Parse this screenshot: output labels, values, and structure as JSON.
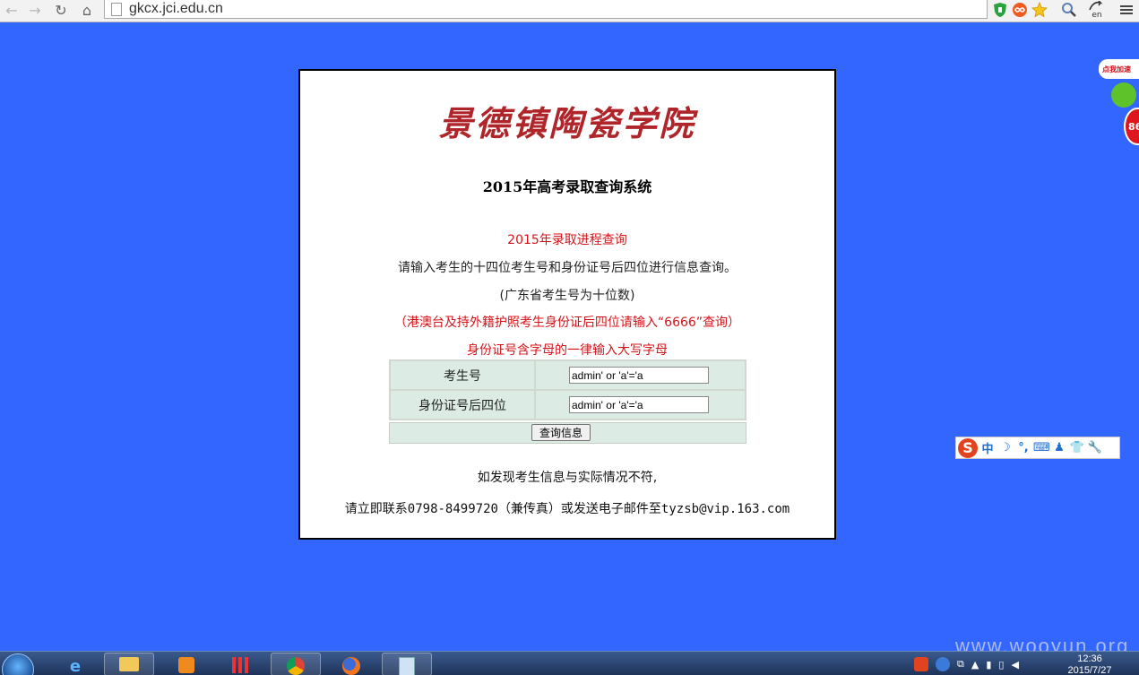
{
  "browser": {
    "url": "gkcx.jci.edu.cn",
    "nav": {
      "back": "←",
      "forward": "→",
      "reload": "↻",
      "home": "⌂"
    },
    "right_icons": [
      "shield-icon",
      "infinity-icon",
      "star-icon",
      "search-zoom-icon",
      "translate-icon",
      "menu-icon"
    ],
    "translate_label": "en"
  },
  "page": {
    "logo_text": "景德镇陶瓷学院",
    "system_title": "2015年高考录取查询系统",
    "progress_title": "2015年录取进程查询",
    "instruction": "请输入考生的十四位考生号和身份证号后四位进行信息查询。",
    "guangdong_note": "(广东省考生号为十位数)",
    "hmt_note": "（港澳台及持外籍护照考生身份证后四位请输入“6666”查询）",
    "uppercase_note": "身份证号含字母的一律输入大写字母",
    "form": {
      "exam_no_label": "考生号",
      "exam_no_value": "admin' or 'a'='a",
      "id_last4_label": "身份证号后四位",
      "id_last4_value": "admin' or 'a'='a",
      "submit_label": "查询信息"
    },
    "footer_line1": "如发现考生信息与实际情况不符,",
    "footer_line2": "请立即联系0798-8499720（兼传真）或发送电子邮件至tyzsb@vip.163.com"
  },
  "widgets": {
    "speed_label": "点我加速",
    "speed_value": "86",
    "ime": {
      "logo": "S",
      "items": [
        "中",
        "☽",
        "°,",
        "⌨",
        "♟",
        "👕",
        "🔧"
      ]
    }
  },
  "taskbar": {
    "clock_time": "12:36",
    "clock_date": "2015/7/27"
  },
  "watermark": "www.wooyun.org",
  "colors": {
    "background": "#3366ff",
    "accent_red": "#d4141a",
    "logo_red": "#b0252a",
    "table_bg": "#dcece4"
  }
}
